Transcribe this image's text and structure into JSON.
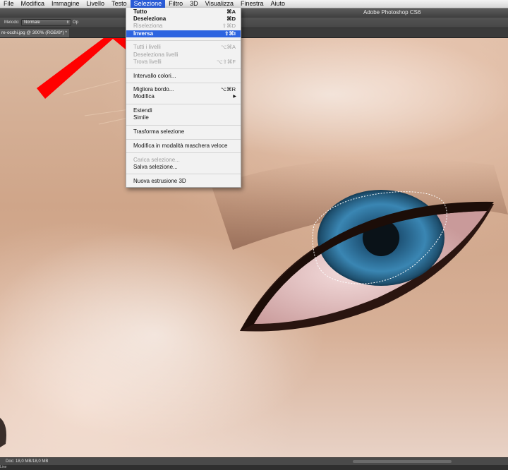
{
  "menubar": {
    "items": [
      {
        "label": "File"
      },
      {
        "label": "Modifica"
      },
      {
        "label": "Immagine"
      },
      {
        "label": "Livello"
      },
      {
        "label": "Testo"
      },
      {
        "label": "Selezione"
      },
      {
        "label": "Filtro"
      },
      {
        "label": "3D"
      },
      {
        "label": "Visualizza"
      },
      {
        "label": "Finestra"
      },
      {
        "label": "Aiuto"
      }
    ],
    "active_index": 5
  },
  "window": {
    "title": "Adobe Photoshop CS6"
  },
  "options": {
    "method_label": "Metodo:",
    "method_value": "Normale",
    "opacity_label": "Op"
  },
  "document": {
    "tab_title": "re-occhi.jpg @ 300% (RGB/8*) *"
  },
  "status": {
    "doc_size": "Doc: 18,0 MB/18,0 MB",
    "timeline": "Line"
  },
  "menu": {
    "items": [
      {
        "label": "Tutto",
        "shortcut": "⌘A",
        "bold": true
      },
      {
        "label": "Deseleziona",
        "shortcut": "⌘D",
        "bold": true
      },
      {
        "label": "Riseleziona",
        "shortcut": "⇧⌘D",
        "disabled": true
      },
      {
        "label": "Inversa",
        "shortcut": "⇧⌘I",
        "highlighted": true,
        "bold": true
      },
      {
        "separator": true
      },
      {
        "label": "Tutti i livelli",
        "shortcut": "⌥⌘A",
        "disabled": true
      },
      {
        "label": "Deseleziona livelli",
        "disabled": true
      },
      {
        "label": "Trova livelli",
        "shortcut": "⌥⇧⌘F",
        "disabled": true
      },
      {
        "separator": true
      },
      {
        "label": "Intervallo colori..."
      },
      {
        "separator": true
      },
      {
        "label": "Migliora bordo...",
        "shortcut": "⌥⌘R"
      },
      {
        "label": "Modifica",
        "submenu": true
      },
      {
        "separator": true
      },
      {
        "label": "Estendi"
      },
      {
        "label": "Simile"
      },
      {
        "separator": true
      },
      {
        "label": "Trasforma selezione"
      },
      {
        "separator": true
      },
      {
        "label": "Modifica in modalità maschera veloce"
      },
      {
        "separator": true
      },
      {
        "label": "Carica selezione...",
        "disabled": true
      },
      {
        "label": "Salva selezione..."
      },
      {
        "separator": true
      },
      {
        "label": "Nuova estrusione 3D"
      }
    ]
  },
  "colors": {
    "arrow": "#ff0000",
    "highlight": "#2d64e0",
    "iris": "#2f6f96"
  }
}
